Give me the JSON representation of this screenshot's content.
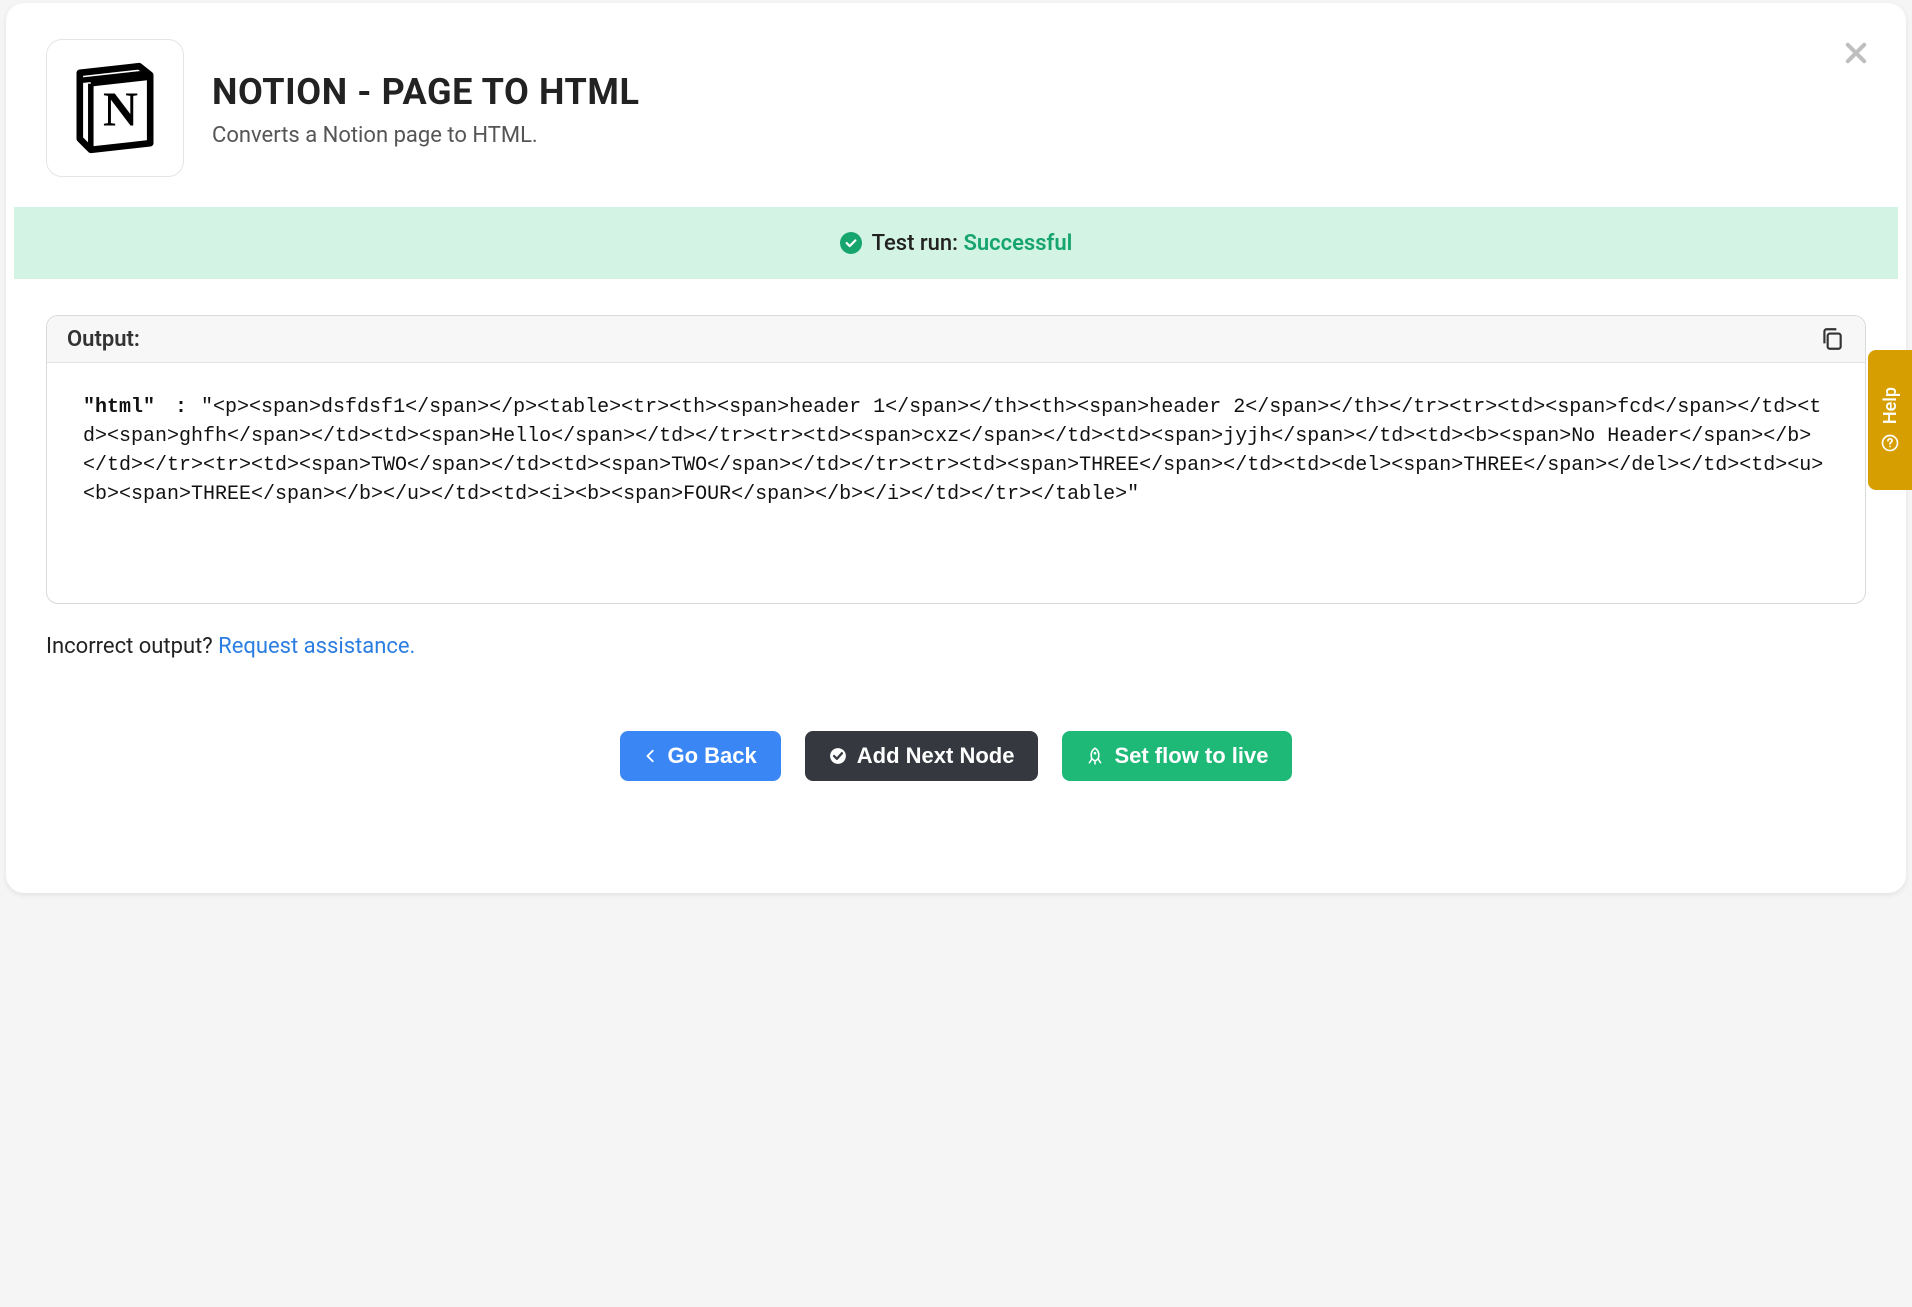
{
  "header": {
    "title": "NOTION - PAGE TO HTML",
    "subtitle": "Converts a Notion page to HTML."
  },
  "status": {
    "prefix": "Test run: ",
    "result": "Successful"
  },
  "output": {
    "label": "Output:",
    "json_key": "\"html\"",
    "json_value": "\"<p><span>dsfdsf1</span></p><table><tr><th><span>header 1</span></th><th><span>header 2</span></th></tr><tr><td><span>fcd</span></td><td><span>ghfh</span></td><td><span>Hello</span></td></tr><tr><td><span>cxz</span></td><td><span>jyjh</span></td><td><b><span>No Header</span></b></td></tr><tr><td><span>TWO</span></td><td><span>TWO</span></td></tr><tr><td><span>THREE</span></td><td><del><span>THREE</span></del></td><td><u><b><span>THREE</span></b></u></td><td><i><b><span>FOUR</span></b></i></td></tr></table>\""
  },
  "assistance": {
    "text": "Incorrect output? ",
    "link": "Request assistance."
  },
  "actions": {
    "go_back": "Go Back",
    "add_next": "Add Next Node",
    "set_live": "Set flow to live"
  },
  "help": {
    "label": "Help"
  }
}
